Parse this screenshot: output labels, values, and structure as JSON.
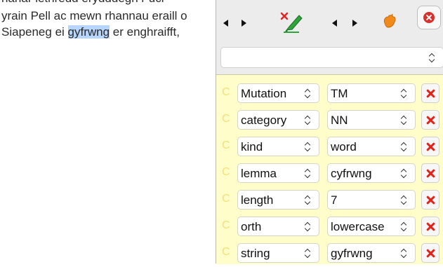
{
  "document": {
    "lines": [
      "nanar lethredd erydddegn r ucr",
      "yrain Pell ac mewn rhannau eraill o",
      "Siapeneg ei ",
      "gyfrwng",
      " er enghraifft,"
    ]
  },
  "toolbar": {
    "icons": [
      "previous-arrow-icon",
      "next-arrow-icon",
      "delete-annotation-icon",
      "previous-arrow-icon",
      "next-arrow-icon",
      "color-shape-icon",
      "close-icon"
    ]
  },
  "type_select": {
    "value": ""
  },
  "features": [
    {
      "name": "Mutation",
      "value": "TM"
    },
    {
      "name": "category",
      "value": "NN"
    },
    {
      "name": "kind",
      "value": "word"
    },
    {
      "name": "lemma",
      "value": "cyfrwng"
    },
    {
      "name": "length",
      "value": "7"
    },
    {
      "name": "orth",
      "value": "lowercase"
    },
    {
      "name": "string",
      "value": "gyfrwng"
    }
  ],
  "row_marker": "C",
  "colors": {
    "highlight": "#b6d5ff",
    "panel_bg": "#fffecb",
    "delete_x": "#e2231a",
    "accent_orange": "#f08a1c"
  }
}
